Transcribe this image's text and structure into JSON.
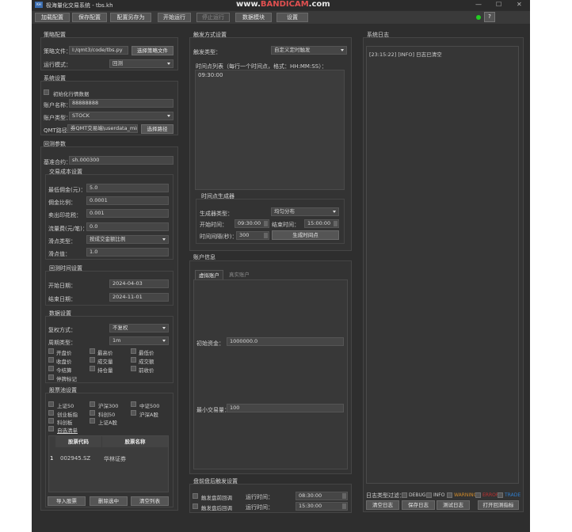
{
  "window": {
    "title": "极海量化交易系统 - tbs.kh",
    "watermark_prefix": "www.",
    "watermark_brand": "BANDICAM",
    "watermark_suffix": ".com",
    "minimize": "—",
    "maximize": "☐",
    "close": "✕"
  },
  "toolbar": {
    "load_config": "加载配置",
    "save_config": "保存配置",
    "save_config_as": "配置另存为",
    "start_run": "开始运行",
    "stop_run": "停止运行",
    "data_module": "数据模块",
    "settings": "设置",
    "help": "?"
  },
  "strategy": {
    "title": "策略配置",
    "file_label": "策略文件：",
    "file_value": "I:/qmt3/code/tbs.py",
    "choose_file": "选择策略文件",
    "mode_label": "运行模式：",
    "mode_value": "回测"
  },
  "system": {
    "title": "系统设置",
    "init_quotes": "初始化行情数据",
    "account_name_label": "账户名称：",
    "account_name_value": "88888888",
    "account_type_label": "账户类型：",
    "account_type_value": "STOCK",
    "qmt_path_label": "QMT路径：",
    "qmt_path_value": "券QMT交易端\\userdata_mini",
    "choose_path": "选择路径"
  },
  "backtest": {
    "title": "回测参数",
    "benchmark_label": "基准合约：",
    "benchmark_value": "sh.000300",
    "cost_title": "交易成本设置",
    "min_comm_label": "最低佣金(元)：",
    "min_comm_value": "5.0",
    "comm_rate_label": "佣金比例：",
    "comm_rate_value": "0.0001",
    "stamp_label": "卖出印花税：",
    "stamp_value": "0.001",
    "flow_label": "流量费(元/笔)：",
    "flow_value": "0.0",
    "slip_type_label": "滑点类型：",
    "slip_type_value": "按成交金额比例",
    "slip_val_label": "滑点值：",
    "slip_val_value": "1.0",
    "time_title": "回测时间设置",
    "start_label": "开始日期：",
    "start_value": "2024-04-03",
    "end_label": "结束日期：",
    "end_value": "2024-11-01",
    "data_title": "数据设置",
    "adjust_label": "复权方式：",
    "adjust_value": "不复权",
    "period_label": "周期类型：",
    "period_value": "1m",
    "fields": [
      "开盘价",
      "最高价",
      "最低价",
      "收盘价",
      "成交量",
      "成交额",
      "今结算",
      "持仓量",
      "前收价",
      "停牌标记"
    ],
    "pool_title": "股票池设置",
    "pools": [
      "上证50",
      "沪深300",
      "中证500",
      "创业板指",
      "科创50",
      "沪深A股",
      "科创板",
      "上证A股"
    ],
    "custom_list": "自选清单",
    "table_headers": [
      "股票代码",
      "股票名称"
    ],
    "rows": [
      {
        "idx": "1",
        "code": "002945.SZ",
        "name": "华林证券"
      }
    ],
    "import_btn": "导入股票",
    "delete_btn": "删除选中",
    "clear_btn": "清空列表"
  },
  "trigger": {
    "title": "触发方式设置",
    "type_label": "触发类型：",
    "type_value": "自定义定时触发",
    "list_label": "时间点列表（每行一个时间点，格式：HH:MM:SS）：",
    "list_value": "09:30:00",
    "gen_title": "时间点生成器",
    "gen_type_label": "生成器类型：",
    "gen_type_value": "均匀分布",
    "start_label": "开始时间：",
    "start_value": "09:30:00",
    "end_label": "结束时间：",
    "end_value": "15:00:00",
    "interval_label": "时间间隔(秒)：",
    "interval_value": "300",
    "gen_btn": "生成时间点"
  },
  "account": {
    "title": "账户信息",
    "tab_virtual": "虚拟账户",
    "tab_real": "真实账户",
    "capital_label": "初始资金：",
    "capital_value": "1000000.0",
    "min_trade_label": "最小交易量：",
    "min_trade_value": "100"
  },
  "prepost": {
    "title": "盘前盘后触发设置",
    "pre_label": "触发盘前回调",
    "pre_time_label": "运行时间：",
    "pre_time_value": "08:30:00",
    "post_label": "触发盘后回调",
    "post_time_label": "运行时间：",
    "post_time_value": "15:30:00"
  },
  "log": {
    "title": "系统日志",
    "line": "[23:15:22] [INFO] 日志已清空",
    "filter_label": "日志类型过滤：",
    "levels": [
      {
        "name": "DEBUG",
        "color": "#cfcfcf"
      },
      {
        "name": "INFO",
        "color": "#cfcfcf"
      },
      {
        "name": "WARNING",
        "color": "#d08a2a"
      },
      {
        "name": "ERROR",
        "color": "#c03030"
      },
      {
        "name": "TRADE",
        "color": "#2f7fd0"
      }
    ],
    "clear_btn": "清空日志",
    "save_btn": "保存日志",
    "test_btn": "测试日志",
    "open_btn": "打开回测指标"
  }
}
